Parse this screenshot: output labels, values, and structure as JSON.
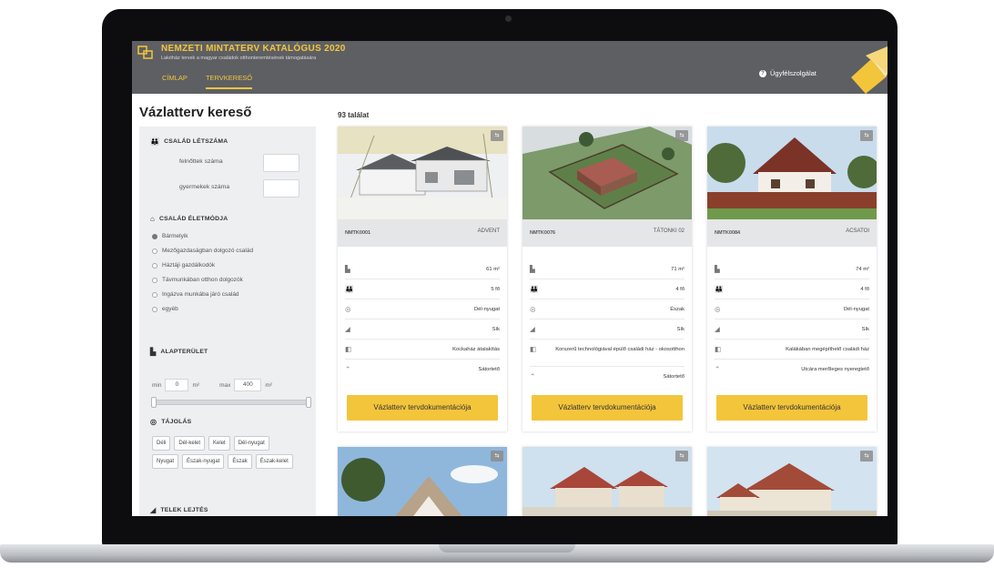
{
  "brand": {
    "title": "NEMZETI MINTATERV KATALÓGUS 2020",
    "subtitle": "Lakóház tervek a magyar családok otthonteremtésének támogatására"
  },
  "nav": {
    "tabs": [
      {
        "label": "CÍMLAP"
      },
      {
        "label": "TERVKERESŐ"
      }
    ]
  },
  "help": {
    "label": "Ügyfélszolgálat"
  },
  "sidebar": {
    "title": "Vázlatterv kereső",
    "family_size": {
      "heading": "CSALÁD LÉTSZÁMA",
      "adults_label": "felnőttek száma",
      "children_label": "gyermekek száma"
    },
    "lifestyle": {
      "heading": "CSALÁD ÉLETMÓDJA",
      "options": [
        "Bármelyik",
        "Mezőgazdaságban dolgozó család",
        "Háztáji gazdálkodók",
        "Távmunkában otthon dolgozók",
        "Ingázva munkába járó család",
        "egyéb"
      ],
      "selected": "Bármelyik"
    },
    "floor_area": {
      "heading": "ALAPTERÜLET",
      "min_label": "min",
      "min_value": "0",
      "max_label": "max",
      "max_value": "400",
      "unit": "m²",
      "range": [
        0,
        400
      ]
    },
    "orientation": {
      "heading": "TÁJOLÁS",
      "options": [
        "Déli",
        "Dél-kelet",
        "Kelet",
        "Dél-nyugat",
        "Nyugat",
        "Észak-nyugat",
        "Észak",
        "Észak-kelet"
      ]
    },
    "slope": {
      "heading": "TELEK LEJTÉS"
    }
  },
  "results": {
    "count_label": "93 találat",
    "cta_label": "Vázlatterv tervdokumentációja",
    "cards": [
      {
        "code": "NMTK0001",
        "name": "ADVENT",
        "specs": [
          "61 m²",
          "5 fő",
          "Dél-nyugat",
          "Sík",
          "Kockaház átalakítás",
          "Sátortető"
        ]
      },
      {
        "code": "NMTK0076",
        "name": "TÁTONKI 02",
        "specs": [
          "71 m²",
          "4 fő",
          "Észak",
          "Sík",
          "Korszerű technológiával épülő családi ház - okosotthon",
          "Sátortető"
        ]
      },
      {
        "code": "NMTK0084",
        "name": "ACSATOI",
        "specs": [
          "74 m²",
          "4 fő",
          "Dél-nyugat",
          "Sík",
          "Kalákában megépíthető családi ház",
          "Utcára merőleges nyeregtető"
        ]
      }
    ]
  },
  "icons": {
    "area": "floor-plan-icon",
    "people": "family-icon",
    "orientation": "compass-icon",
    "terrain": "terrain-icon",
    "type": "building-type-icon",
    "roof": "roof-icon",
    "compare": "compare-icon"
  },
  "colors": {
    "accent": "#f3c53b",
    "header": "#5d5f63"
  }
}
